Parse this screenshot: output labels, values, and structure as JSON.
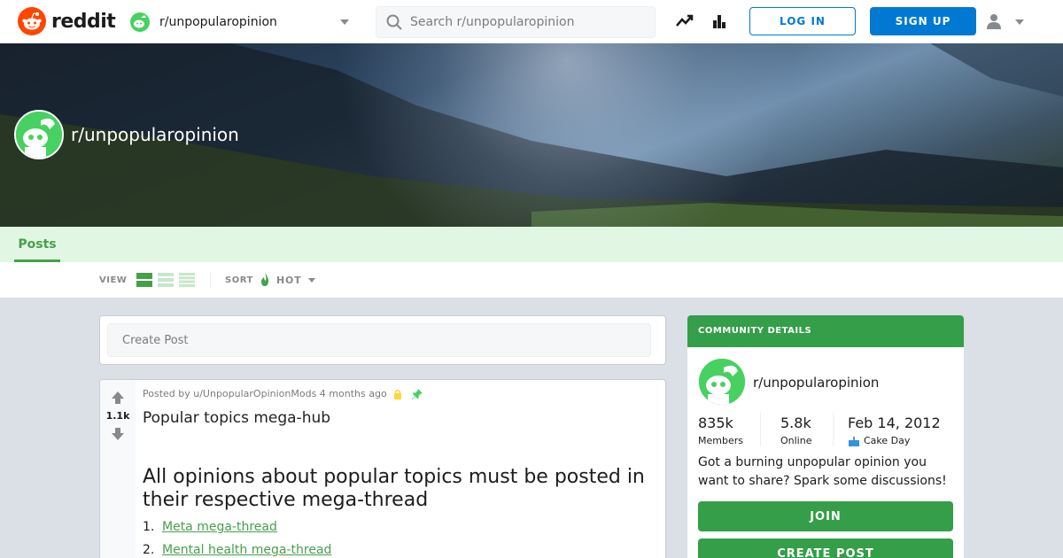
{
  "header": {
    "logo_text": "reddit",
    "community": "r/unpopularopinion",
    "search_placeholder": "Search r/unpopularopinion",
    "login_label": "LOG IN",
    "signup_label": "SIGN UP",
    "icons": [
      "trending-icon",
      "stats-icon",
      "user-icon",
      "chevron-down-icon"
    ]
  },
  "banner": {
    "title": "r/unpopularopinion"
  },
  "tabs": [
    {
      "label": "Posts",
      "active": true
    }
  ],
  "viewbar": {
    "view_label": "VIEW",
    "sort_label": "SORT",
    "sort_value": "HOT",
    "view_options": [
      "card",
      "classic",
      "compact"
    ]
  },
  "create_post": {
    "placeholder": "Create Post"
  },
  "post": {
    "vote_count": "1.1k",
    "meta": "Posted by u/UnpopularOpinionMods 4 months ago",
    "title": "Popular topics mega-hub",
    "body_heading": "All opinions about popular topics must be posted in their respective mega-thread",
    "list": [
      {
        "num": "1.",
        "text": "Meta mega-thread"
      },
      {
        "num": "2.",
        "text": "Mental health mega-thread"
      }
    ]
  },
  "sidebar": {
    "header": "COMMUNITY DETAILS",
    "name": "r/unpopularopinion",
    "members_value": "835k",
    "members_label": "Members",
    "online_value": "5.8k",
    "online_label": "Online",
    "cake_value": "Feb 14, 2012",
    "cake_label": "Cake Day",
    "description": "Got a burning unpopular opinion you want to share? Spark some discussions!",
    "join_label": "JOIN",
    "create_label": "CREATE POST"
  },
  "colors": {
    "reddit_orange": "#ff4500",
    "blue": "#0079d3",
    "community_green": "#349e48",
    "tab_bg": "#e1f7e4"
  }
}
